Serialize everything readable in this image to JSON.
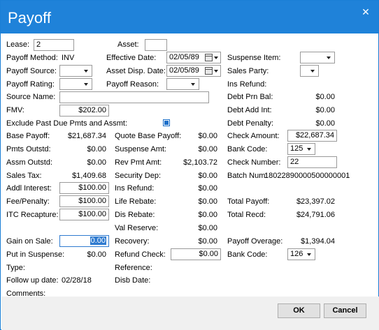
{
  "title": "Payoff",
  "icons": {
    "close": "close-icon",
    "calendar": "calendar-icon",
    "dropdown": "chevron-down-icon"
  },
  "colors": {
    "titlebar": "#1f82d9",
    "accent": "#2f7bd0"
  },
  "col1": {
    "lease_label": "Lease:",
    "lease_value": "2",
    "payoff_method_label": "Payoff Method:",
    "payoff_method_value": "INV",
    "payoff_source_label": "Payoff Source:",
    "payoff_rating_label": "Payoff Rating:",
    "source_name_label": "Source Name:",
    "fmv_label": "FMV:",
    "fmv_value": "$202.00",
    "exclude_label": "Exclude Past Due Pmts and Assmt:",
    "base_payoff_label": "Base Payoff:",
    "base_payoff_value": "$21,687.34",
    "pmts_outstd_label": "Pmts Outstd:",
    "pmts_outstd_value": "$0.00",
    "assm_outstd_label": "Assm Outstd:",
    "assm_outstd_value": "$0.00",
    "sales_tax_label": "Sales Tax:",
    "sales_tax_value": "$1,409.68",
    "addl_interest_label": "Addl Interest:",
    "addl_interest_value": "$100.00",
    "fee_penalty_label": "Fee/Penalty:",
    "fee_penalty_value": "$100.00",
    "itc_recapture_label": "ITC Recapture:",
    "itc_recapture_value": "$100.00",
    "gain_on_sale_label": "Gain on Sale:",
    "gain_on_sale_value": "0.00",
    "put_in_suspense_label": "Put in Suspense:",
    "put_in_suspense_value": "$0.00",
    "type_label": "Type:",
    "follow_up_label": "Follow up date:",
    "follow_up_value": "02/28/18",
    "comments_label": "Comments:"
  },
  "col2": {
    "asset_label": "Asset:",
    "effective_date_label": "Effective Date:",
    "effective_date_value": "02/05/89",
    "asset_disp_date_label": "Asset Disp. Date:",
    "asset_disp_date_value": "02/05/89",
    "payoff_reason_label": "Payoff Reason:",
    "quote_base_payoff_label": "Quote Base Payoff:",
    "quote_base_payoff_value": "$0.00",
    "suspense_amt_label": "Suspense Amt:",
    "suspense_amt_value": "$0.00",
    "rev_pmt_amt_label": "Rev Pmt Amt:",
    "rev_pmt_amt_value": "$2,103.72",
    "security_dep_label": "Security Dep:",
    "security_dep_value": "$0.00",
    "ins_refund_label": "Ins Refund:",
    "ins_refund_value": "$0.00",
    "life_rebate_label": "Life Rebate:",
    "life_rebate_value": "$0.00",
    "dis_rebate_label": "Dis Rebate:",
    "dis_rebate_value": "$0.00",
    "val_reserve_label": "Val Reserve:",
    "val_reserve_value": "$0.00",
    "recovery_label": "Recovery:",
    "recovery_value": "$0.00",
    "refund_check_label": "Refund Check:",
    "refund_check_value": "$0.00",
    "reference_label": "Reference:",
    "disb_date_label": "Disb Date:"
  },
  "col3": {
    "suspense_item_label": "Suspense Item:",
    "sales_party_label": "Sales Party:",
    "ins_refund_label": "Ins Refund:",
    "debt_prn_bal_label": "Debt Prn Bal:",
    "debt_prn_bal_value": "$0.00",
    "debt_add_int_label": "Debt Add Int:",
    "debt_add_int_value": "$0.00",
    "debt_penalty_label": "Debt Penalty:",
    "debt_penalty_value": "$0.00",
    "check_amount_label": "Check Amount:",
    "check_amount_value": "$22,687.34",
    "bank_code_label": "Bank Code:",
    "bank_code_value": "125",
    "check_number_label": "Check Number:",
    "check_number_value": "22",
    "batch_num_label": "Batch Num:",
    "batch_num_value": "18022890000500000001",
    "total_payoff_label": "Total Payoff:",
    "total_payoff_value": "$23,397.02",
    "total_recd_label": "Total Recd:",
    "total_recd_value": "$24,791.06",
    "payoff_overage_label": "Payoff Overage:",
    "payoff_overage_value": "$1,394.04",
    "bank_code2_label": "Bank Code:",
    "bank_code2_value": "126"
  },
  "buttons": {
    "ok": "OK",
    "cancel": "Cancel"
  }
}
